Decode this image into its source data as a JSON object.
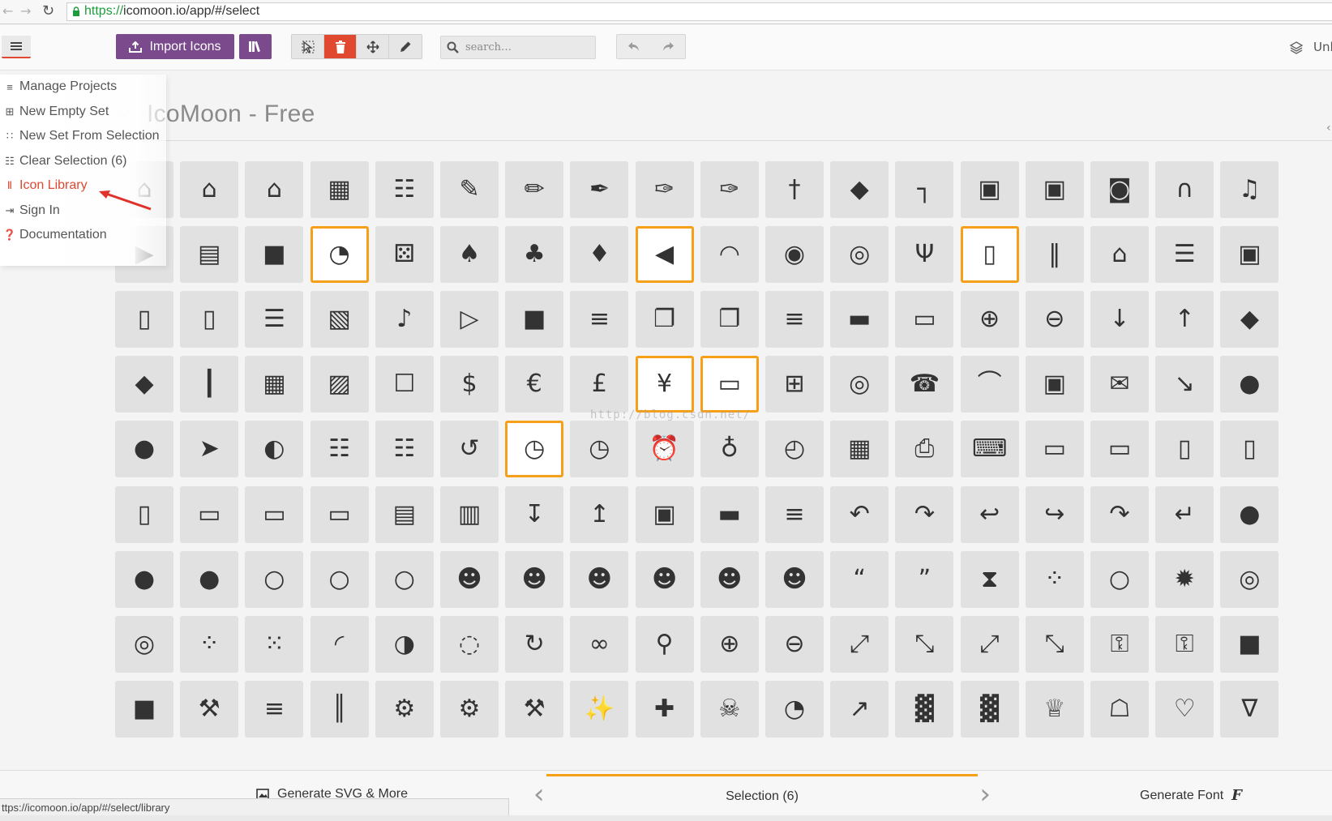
{
  "browser": {
    "back_icon": "back-arrow-icon",
    "forward_icon": "forward-arrow-icon",
    "url_scheme": "https://",
    "url_rest": "icomoon.io/app/#/select"
  },
  "toolbar": {
    "import_label": "Import Icons",
    "search_placeholder": "search…",
    "projects_label": "Unl",
    "accent_color": "#7a4a8c",
    "delete_color": "#e0482f"
  },
  "menu": {
    "items": [
      {
        "label": "Manage Projects",
        "icon": "layers-icon"
      },
      {
        "label": "New Empty Set",
        "icon": "plus-box-icon"
      },
      {
        "label": "New Set From Selection",
        "icon": "grid-plus-icon"
      },
      {
        "label": "Clear Selection (6)",
        "icon": "grid-icon"
      },
      {
        "label": "Icon Library",
        "icon": "library-icon",
        "active": true
      },
      {
        "label": "Sign In",
        "icon": "sign-in-icon"
      },
      {
        "label": "Documentation",
        "icon": "question-icon"
      }
    ]
  },
  "set": {
    "title": "IcoMoon - Free"
  },
  "watermark": "http://blog.csdn.net/",
  "icons": [
    [
      "home",
      "home2",
      "home3",
      "office",
      "newspaper",
      "pencil",
      "pencil2",
      "quill",
      "pen",
      "blog",
      "eyedropper",
      "droplet",
      "paint-format",
      "image",
      "images",
      "camera",
      "headphones",
      "music"
    ],
    [
      "play",
      "film",
      "video-camera",
      "pacman",
      "dice",
      "spades",
      "clubs",
      "diamonds",
      "bullhorn",
      "connection",
      "podcast",
      "feed",
      "mic",
      "book",
      "books",
      "library",
      "file-text",
      "profile"
    ],
    [
      "file-empty",
      "files-empty",
      "file-text2",
      "file-picture",
      "file-music",
      "file-play",
      "file-video",
      "file-zip",
      "copy",
      "paste",
      "stack",
      "folder",
      "folder-open",
      "folder-plus",
      "folder-minus",
      "folder-download",
      "folder-upload",
      "price-tag"
    ],
    [
      "price-tags",
      "barcode",
      "qrcode",
      "ticket",
      "cart",
      "coin-dollar",
      "coin-euro",
      "coin-pound",
      "coin-yen",
      "credit-card",
      "calculator",
      "lifebuoy",
      "phone",
      "phone-hang-up",
      "address-book",
      "envelop",
      "pushpin",
      "location"
    ],
    [
      "location2",
      "compass",
      "compass2",
      "map",
      "map2",
      "history",
      "clock",
      "clock2",
      "alarm",
      "bell",
      "stopwatch",
      "calendar",
      "printer",
      "keyboard",
      "display",
      "laptop",
      "mobile",
      "mobile2"
    ],
    [
      "tablet",
      "tv",
      "drawer",
      "drawer2",
      "box-add",
      "box-remove",
      "download",
      "upload",
      "floppy-disk",
      "drive",
      "database",
      "undo",
      "redo",
      "undo2",
      "redo2",
      "forward",
      "reply",
      "bubble"
    ],
    [
      "bubbles",
      "bubbles2",
      "bubble2",
      "bubbles3",
      "bubbles4",
      "user",
      "users",
      "user-plus",
      "user-minus",
      "user-check",
      "user-tie",
      "quotes-left",
      "quotes-right",
      "hour-glass",
      "spinner",
      "spinner2",
      "spinner3",
      "spinner4"
    ],
    [
      "spinner5",
      "spinner6",
      "spinner7",
      "spinner8",
      "spinner9",
      "spinner10",
      "spinner11",
      "binoculars",
      "search",
      "zoom-in",
      "zoom-out",
      "enlarge",
      "shrink",
      "enlarge2",
      "shrink2",
      "key",
      "key2",
      "lock"
    ],
    [
      "unlocked",
      "wrench",
      "equalizer",
      "equalizer2",
      "cog",
      "cogs",
      "hammer",
      "magic-wand",
      "aid-kit",
      "bug",
      "pie-chart",
      "stats-dots",
      "stats-bars",
      "stats-bars2",
      "trophy",
      "gift",
      "glass",
      "glass2"
    ]
  ],
  "selected": [
    "3-1",
    "8-1",
    "13-1",
    "8-3",
    "9-3",
    "6-4"
  ],
  "bottom": {
    "generate_svg": "Generate SVG & More",
    "selection": "Selection (6)",
    "generate_font": "Generate Font"
  },
  "status_url": "ttps://icomoon.io/app/#/select/library"
}
